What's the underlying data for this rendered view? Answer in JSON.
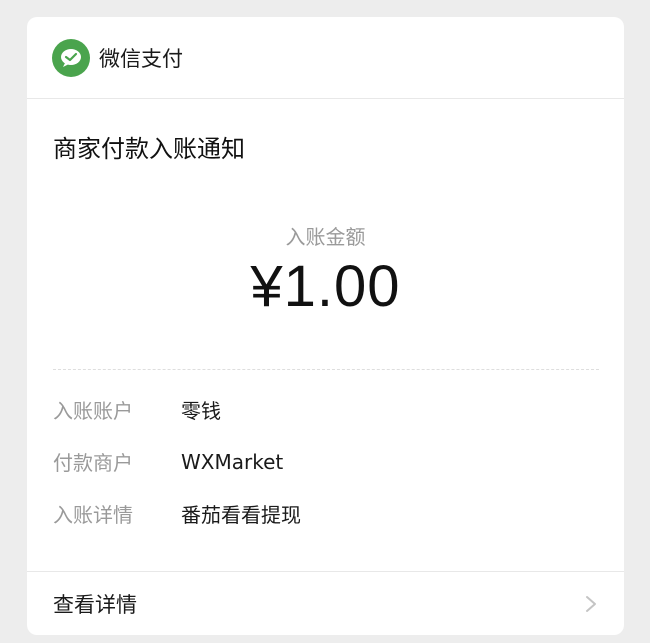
{
  "header": {
    "brand": "微信支付",
    "icon": "wechat-pay-icon",
    "brand_color": "#4aa44d"
  },
  "notice": {
    "title": "商家付款入账通知",
    "amount_label": "入账金额",
    "amount": "¥1.00"
  },
  "details": [
    {
      "key": "入账账户",
      "value": "零钱"
    },
    {
      "key": "付款商户",
      "value": "WXMarket"
    },
    {
      "key": "入账详情",
      "value": "番茄看看提现"
    }
  ],
  "footer": {
    "label": "查看详情",
    "icon": "chevron-right-icon"
  }
}
